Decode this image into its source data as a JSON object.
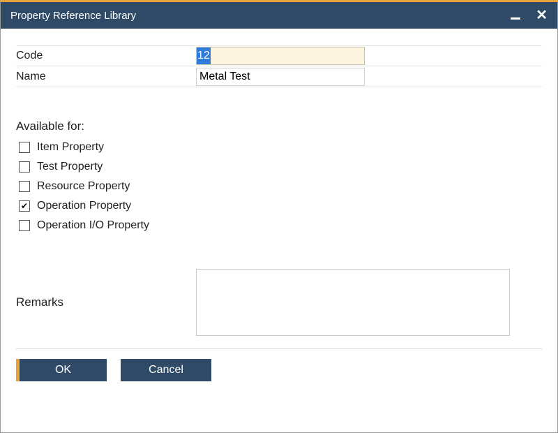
{
  "window": {
    "title": "Property Reference Library"
  },
  "fields": {
    "code_label": "Code",
    "code_value": "12",
    "name_label": "Name",
    "name_value": "Metal Test"
  },
  "available": {
    "heading": "Available for:",
    "options": [
      {
        "label": "Item Property",
        "checked": false
      },
      {
        "label": "Test Property",
        "checked": false
      },
      {
        "label": "Resource Property",
        "checked": false
      },
      {
        "label": "Operation Property",
        "checked": true
      },
      {
        "label": "Operation I/O Property",
        "checked": false
      }
    ]
  },
  "remarks": {
    "label": "Remarks",
    "value": ""
  },
  "buttons": {
    "ok": "OK",
    "cancel": "Cancel"
  }
}
